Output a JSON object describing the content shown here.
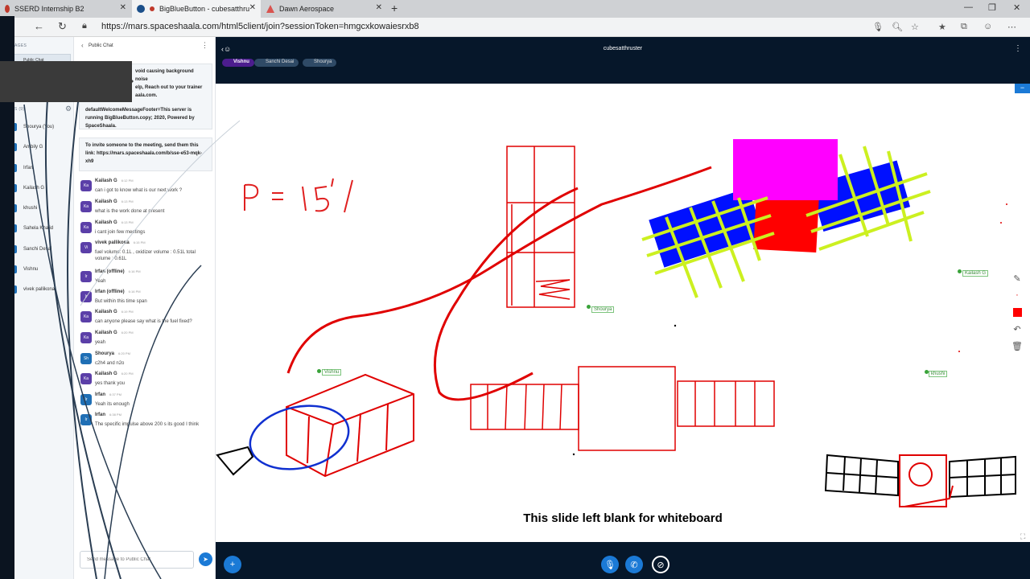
{
  "browser": {
    "tabs": [
      {
        "label": "SSERD Internship B2",
        "icon_color": "#c0392b"
      },
      {
        "label": "BigBlueButton - cubesatthru",
        "icon_color": "#c0392b"
      },
      {
        "label": "Dawn Aerospace",
        "icon_color": "#d9534f"
      }
    ],
    "new_tab": "+",
    "url": "https://mars.spaceshaala.com/html5client/join?sessionToken=hmgcxkowaiesrxb8",
    "back_icon": "back-arrow-icon",
    "forward_icon": "forward-arrow-icon",
    "reload_icon": "reload-icon"
  },
  "users_panel": {
    "messages_label": "AGES",
    "public_chat_item": "Public Chat",
    "users_label": "S (9)",
    "users": [
      {
        "name": "Shourya (You)",
        "color": "#1f6fb5"
      },
      {
        "name": "Ambily G",
        "color": "#1f6fb5"
      },
      {
        "name": "Irfan",
        "color": "#1f6fb5"
      },
      {
        "name": "Kailash G",
        "color": "#1f6fb5"
      },
      {
        "name": "khushi",
        "color": "#1f6fb5"
      },
      {
        "name": "Sahela Khalid",
        "color": "#1f6fb5"
      },
      {
        "name": "Sanchi Desai",
        "color": "#1f6fb5"
      },
      {
        "name": "Vishnu",
        "color": "#1f6fb5"
      },
      {
        "name": "vivek pallikona",
        "color": "#1f6fb5"
      }
    ]
  },
  "chat": {
    "title": "Public Chat",
    "welcome_line1": "void causing background noise",
    "welcome_line2": "elp, Reach out to your trainer",
    "welcome_line3": "aala.com.",
    "footer_text": "defaultWelcomeMessageFooter=This server is running BigBlueButton.copy; 2020, Powered by SpaceShaala.",
    "invite_text": "To invite someone to the meeting, send them this link: https://mars.spaceshaala.com/b/sse-e53-mqk-xh9",
    "messages": [
      {
        "initials": "Ka",
        "name": "Kailash G",
        "time": "6:12 PM",
        "text": "can i got to know what is our next work ?",
        "color": "#5b3fa8"
      },
      {
        "initials": "Ka",
        "name": "Kailash G",
        "time": "6:13 PM",
        "text": "what is the work done at present",
        "color": "#5b3fa8"
      },
      {
        "initials": "Ka",
        "name": "Kailash G",
        "time": "6:13 PM",
        "text": "i cant join few meetings",
        "color": "#5b3fa8"
      },
      {
        "initials": "Vi",
        "name": "vivek pallikona",
        "time": "6:15 PM",
        "text": "fuel volume: 0.1L , oxidizer volume : 0.51L total volume : 0.61L",
        "color": "#5b3fa8"
      },
      {
        "initials": "Ir",
        "name": "Irfan (offline)",
        "time": "6:16 PM",
        "text": "Yeah",
        "color": "#5b3fa8"
      },
      {
        "initials": "Ir",
        "name": "Irfan (offline)",
        "time": "6:16 PM",
        "text": "But within this time span",
        "color": "#5b3fa8"
      },
      {
        "initials": "Ka",
        "name": "Kailash G",
        "time": "6:19 PM",
        "text": "can anyone please say what is the fuel fixed?",
        "color": "#5b3fa8"
      },
      {
        "initials": "Ka",
        "name": "Kailash G",
        "time": "6:20 PM",
        "text": "yeah",
        "color": "#5b3fa8"
      },
      {
        "initials": "Sh",
        "name": "Shourya",
        "time": "6:20 PM",
        "text": "c2h4 and n2o",
        "color": "#1f6fb5"
      },
      {
        "initials": "Ka",
        "name": "Kailash G",
        "time": "6:20 PM",
        "text": "yes thank you",
        "color": "#5b3fa8"
      },
      {
        "initials": "Ir",
        "name": "Irfan",
        "time": "6:37 PM",
        "text": "Yeah its enough",
        "color": "#1f6fb5"
      },
      {
        "initials": "Ir",
        "name": "Irfan",
        "time": "6:38 PM",
        "text": "The specific impulse above 200 s its good I think",
        "color": "#1f6fb5"
      }
    ],
    "input_placeholder": "Send message to Public Chat"
  },
  "meeting": {
    "title": "cubesatthruster",
    "speakers": [
      {
        "name": "Vishnu",
        "active": true
      },
      {
        "name": "Sanchi Desai",
        "active": false
      },
      {
        "name": "Shourya",
        "active": false
      }
    ]
  },
  "whiteboard": {
    "formula_text": "P = 15'/",
    "caption": "This slide left blank for whiteboard",
    "cursors": [
      "Shourya",
      "Vishnu",
      "Kailash G",
      "khushi"
    ],
    "tool_icons": [
      "pencil-icon",
      "dot-icon",
      "color-swatch",
      "undo-icon",
      "trash-icon"
    ],
    "active_color": "#ff0000"
  },
  "bottombar": {
    "actions_icon": "plus-icon",
    "mic_icon": "microphone-icon",
    "phone_icon": "phone-icon",
    "video_icon": "video-off-icon"
  }
}
